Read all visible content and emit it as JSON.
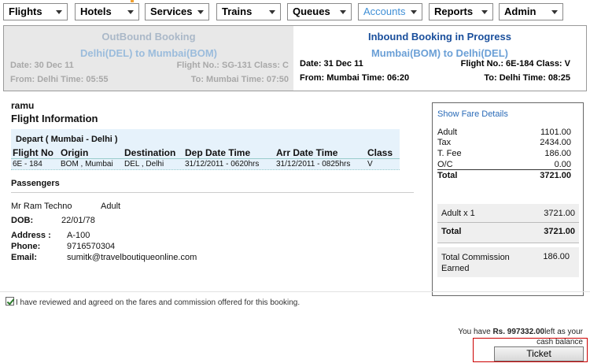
{
  "nav": {
    "items": [
      "Flights",
      "Hotels",
      "Services",
      "Trains",
      "Queues",
      "Accounts",
      "Reports",
      "Admin"
    ],
    "active": "Accounts"
  },
  "outbound": {
    "title": "OutBound Booking",
    "route": "Delhi(DEL) to Mumbai(BOM)",
    "date": "Date: 30 Dec 11",
    "flight": "Flight No.: SG-131 Class: C",
    "from": "From: Delhi Time: 05:55",
    "to": "To: Mumbai Time: 07:50"
  },
  "inbound": {
    "title": "Inbound Booking in Progress",
    "route": "Mumbai(BOM) to Delhi(DEL)",
    "date": "Date: 31 Dec 11",
    "flight": "Flight No.: 6E-184 Class: V",
    "from": "From: Mumbai Time: 06:20",
    "to": "To: Delhi Time: 08:25"
  },
  "passenger_name": "ramu",
  "flight_info_title": "Flight Information",
  "depart": {
    "title": "Depart ( Mumbai - Delhi )",
    "headers": [
      "Flight No",
      "Origin",
      "Destination",
      "Dep Date Time",
      "Arr Date Time",
      "Class"
    ],
    "row": [
      "6E - 184",
      "BOM , Mumbai",
      "DEL , Delhi",
      "31/12/2011 - 0620hrs",
      "31/12/2011 - 0825hrs",
      "V"
    ]
  },
  "passengers": {
    "title": "Passengers",
    "name": "Mr Ram Techno",
    "type": "Adult",
    "dob_label": "DOB:",
    "dob": "22/01/78",
    "address_label": "Address :",
    "address": "A-100",
    "phone_label": "Phone:",
    "phone": "9716570304",
    "email_label": "Email:",
    "email": "sumitk@travelboutiqueonline.com"
  },
  "fare": {
    "link": "Show Fare Details",
    "rows": [
      {
        "label": "Adult",
        "value": "1101.00"
      },
      {
        "label": "Tax",
        "value": "2434.00"
      },
      {
        "label": "T. Fee",
        "value": "186.00"
      },
      {
        "label": "O/C",
        "value": "0.00"
      }
    ],
    "total_label": "Total",
    "total_value": "3721.00",
    "adult_x_label": "Adult x 1",
    "adult_x_value": "3721.00",
    "total2_label": "Total",
    "total2_value": "3721.00",
    "commission_label": "Total Commission Earned",
    "commission_value": "186.00"
  },
  "agreement": "I have reviewed and agreed on the fares and commission offered for this booking.",
  "balance": {
    "prefix": "You have",
    "amount": "Rs. 997332.00",
    "suffix": "left as your cash balance"
  },
  "ticket_label": "Ticket"
}
